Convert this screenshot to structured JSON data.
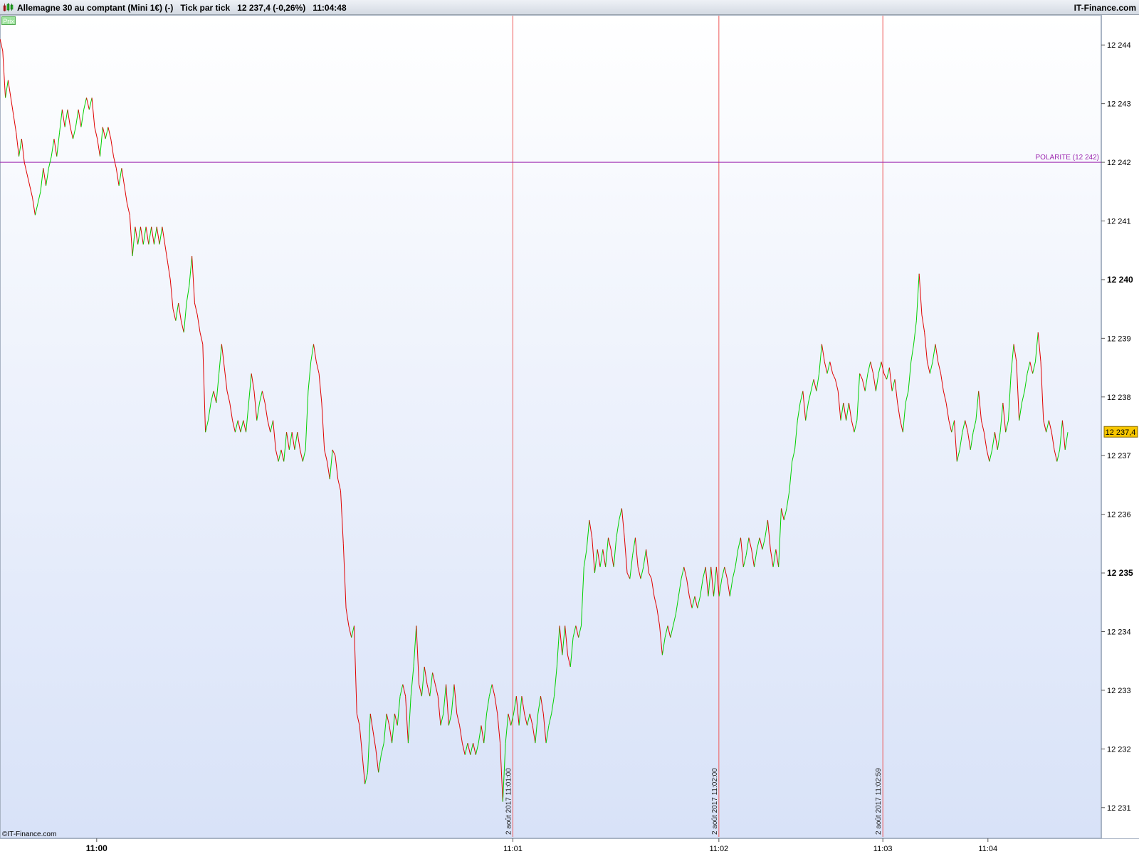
{
  "header": {
    "title": "Allemagne 30 au comptant (Mini 1€) (-)   Tick par tick   12 237,4 (-0,26%)   11:04:48",
    "brand": "IT-Finance.com"
  },
  "chart_controls": {
    "prix_label": "Prix"
  },
  "footer": {
    "copyright": "©IT-Finance.com"
  },
  "colors": {
    "up": "#00d000",
    "down": "#e00000",
    "polarity": "#9c27b0",
    "vline": "#ee5a5a",
    "current_badge": "#f7c600"
  },
  "chart_data": {
    "type": "line",
    "title": "Allemagne 30 au comptant (Mini 1€) (-)",
    "subtitle": "Tick par tick",
    "ylim": [
      12230.5,
      12244.5
    ],
    "y_ticks": [
      {
        "value": 12231,
        "label": "12 231",
        "bold": false
      },
      {
        "value": 12232,
        "label": "12 232",
        "bold": false
      },
      {
        "value": 12233,
        "label": "12 233",
        "bold": false
      },
      {
        "value": 12234,
        "label": "12 234",
        "bold": false
      },
      {
        "value": 12235,
        "label": "12 235",
        "bold": true
      },
      {
        "value": 12236,
        "label": "12 236",
        "bold": false
      },
      {
        "value": 12237,
        "label": "12 237",
        "bold": false
      },
      {
        "value": 12238,
        "label": "12 238",
        "bold": false
      },
      {
        "value": 12239,
        "label": "12 239",
        "bold": false
      },
      {
        "value": 12240,
        "label": "12 240",
        "bold": true
      },
      {
        "value": 12241,
        "label": "12 241",
        "bold": false
      },
      {
        "value": 12242,
        "label": "12 242",
        "bold": false
      },
      {
        "value": 12243,
        "label": "12 243",
        "bold": false
      },
      {
        "value": 12244,
        "label": "12 244",
        "bold": false
      }
    ],
    "x_ticks": [
      {
        "tick": 23,
        "label": "11:00",
        "bold": true
      },
      {
        "tick": 122,
        "label": "11:01",
        "bold": false
      },
      {
        "tick": 171,
        "label": "11:02",
        "bold": false
      },
      {
        "tick": 210,
        "label": "11:03",
        "bold": false
      },
      {
        "tick": 235,
        "label": "11:04",
        "bold": false
      }
    ],
    "vertical_markers": [
      {
        "tick": 122,
        "label": "2 août 2017  11:01:00"
      },
      {
        "tick": 171,
        "label": "2 août 2017  11:02:00"
      },
      {
        "tick": 210,
        "label": "2 août 2017  11:02:59"
      }
    ],
    "polarity": {
      "value": 12242,
      "label": "POLARITE (12 242)"
    },
    "current": {
      "value": 12237.4,
      "label": "12 237,4"
    },
    "series": [
      {
        "values": [
          12244.1,
          12243.9,
          12243.1,
          12243.4,
          12243.1,
          12242.8,
          12242.5,
          12242.1,
          12242.4,
          12242.0,
          12241.8,
          12241.6,
          12241.4,
          12241.1,
          12241.3,
          12241.5,
          12241.9,
          12241.6,
          12241.9,
          12242.1,
          12242.4,
          12242.1,
          12242.5,
          12242.9,
          12242.6,
          12242.9,
          12242.6,
          12242.4,
          12242.6,
          12242.9,
          12242.6,
          12242.9,
          12243.1,
          12242.9,
          12243.1,
          12242.6,
          12242.4,
          12242.1,
          12242.6,
          12242.4,
          12242.6,
          12242.4,
          12242.1,
          12241.9,
          12241.6,
          12241.9,
          12241.6,
          12241.3,
          12241.1,
          12240.4,
          12240.9,
          12240.6,
          12240.9,
          12240.6,
          12240.9,
          12240.6,
          12240.9,
          12240.6,
          12240.9,
          12240.6,
          12240.9,
          12240.6,
          12240.3,
          12240.0,
          12239.5,
          12239.3,
          12239.6,
          12239.3,
          12239.1,
          12239.6,
          12239.9,
          12240.4,
          12239.6,
          12239.4,
          12239.1,
          12238.9,
          12237.4,
          12237.6,
          12237.9,
          12238.1,
          12237.9,
          12238.4,
          12238.9,
          12238.5,
          12238.1,
          12237.9,
          12237.6,
          12237.4,
          12237.6,
          12237.4,
          12237.6,
          12237.4,
          12237.9,
          12238.4,
          12238.1,
          12237.6,
          12237.9,
          12238.1,
          12237.9,
          12237.6,
          12237.4,
          12237.6,
          12237.1,
          12236.9,
          12237.1,
          12236.9,
          12237.4,
          12237.1,
          12237.4,
          12237.1,
          12237.4,
          12237.1,
          12236.9,
          12237.1,
          12238.1,
          12238.6,
          12238.9,
          12238.6,
          12238.4,
          12237.9,
          12237.1,
          12236.9,
          12236.6,
          12237.1,
          12237.0,
          12236.6,
          12236.4,
          12235.5,
          12234.4,
          12234.1,
          12233.9,
          12234.1,
          12232.6,
          12232.4,
          12231.9,
          12231.4,
          12231.6,
          12232.6,
          12232.3,
          12232.0,
          12231.6,
          12231.9,
          12232.1,
          12232.6,
          12232.4,
          12232.1,
          12232.6,
          12232.4,
          12232.9,
          12233.1,
          12232.9,
          12232.1,
          12232.9,
          12233.4,
          12234.1,
          12233.1,
          12232.9,
          12233.4,
          12233.1,
          12232.9,
          12233.3,
          12233.1,
          12232.9,
          12232.4,
          12232.6,
          12233.1,
          12232.4,
          12232.6,
          12233.1,
          12232.6,
          12232.4,
          12232.1,
          12231.9,
          12232.1,
          12231.9,
          12232.1,
          12231.9,
          12232.1,
          12232.4,
          12232.1,
          12232.6,
          12232.9,
          12233.1,
          12232.9,
          12232.6,
          12232.1,
          12231.1,
          12232.1,
          12232.6,
          12232.4,
          12232.6,
          12232.9,
          12232.4,
          12232.9,
          12232.6,
          12232.4,
          12232.6,
          12232.4,
          12232.1,
          12232.6,
          12232.9,
          12232.6,
          12232.1,
          12232.4,
          12232.6,
          12232.9,
          12233.4,
          12234.1,
          12233.6,
          12234.1,
          12233.6,
          12233.4,
          12233.9,
          12234.1,
          12233.9,
          12234.1,
          12235.1,
          12235.4,
          12235.9,
          12235.6,
          12235.0,
          12235.4,
          12235.1,
          12235.4,
          12235.1,
          12235.6,
          12235.4,
          12235.1,
          12235.6,
          12235.9,
          12236.1,
          12235.6,
          12235.0,
          12234.9,
          12235.3,
          12235.6,
          12235.1,
          12234.9,
          12235.1,
          12235.4,
          12235.0,
          12234.9,
          12234.6,
          12234.4,
          12234.1,
          12233.6,
          12233.9,
          12234.1,
          12233.9,
          12234.1,
          12234.3,
          12234.6,
          12234.9,
          12235.1,
          12234.9,
          12234.6,
          12234.4,
          12234.6,
          12234.4,
          12234.6,
          12234.9,
          12235.1,
          12234.6,
          12235.1,
          12234.6,
          12235.1,
          12234.6,
          12234.9,
          12235.1,
          12234.9,
          12234.6,
          12234.9,
          12235.1,
          12235.4,
          12235.6,
          12235.1,
          12235.3,
          12235.6,
          12235.4,
          12235.1,
          12235.4,
          12235.6,
          12235.4,
          12235.6,
          12235.9,
          12235.4,
          12235.1,
          12235.4,
          12235.1,
          12236.1,
          12235.9,
          12236.1,
          12236.4,
          12236.9,
          12237.1,
          12237.6,
          12237.9,
          12238.1,
          12237.6,
          12237.9,
          12238.1,
          12238.3,
          12238.1,
          12238.4,
          12238.9,
          12238.6,
          12238.4,
          12238.6,
          12238.4,
          12238.3,
          12238.1,
          12237.6,
          12237.9,
          12237.6,
          12237.9,
          12237.6,
          12237.4,
          12237.6,
          12238.4,
          12238.3,
          12238.1,
          12238.4,
          12238.6,
          12238.4,
          12238.1,
          12238.4,
          12238.6,
          12238.4,
          12238.3,
          12238.5,
          12238.1,
          12238.3,
          12237.9,
          12237.6,
          12237.4,
          12237.9,
          12238.1,
          12238.6,
          12238.9,
          12239.3,
          12240.1,
          12239.4,
          12239.1,
          12238.6,
          12238.4,
          12238.6,
          12238.9,
          12238.6,
          12238.4,
          12238.1,
          12237.9,
          12237.6,
          12237.4,
          12237.6,
          12236.9,
          12237.1,
          12237.4,
          12237.6,
          12237.4,
          12237.1,
          12237.4,
          12237.6,
          12238.1,
          12237.6,
          12237.4,
          12237.1,
          12236.9,
          12237.1,
          12237.4,
          12237.1,
          12237.4,
          12237.9,
          12237.4,
          12237.6,
          12238.4,
          12238.9,
          12238.6,
          12237.6,
          12237.9,
          12238.1,
          12238.4,
          12238.6,
          12238.4,
          12238.6,
          12239.1,
          12238.6,
          12237.6,
          12237.4,
          12237.6,
          12237.4,
          12237.1,
          12236.9,
          12237.1,
          12237.6,
          12237.1,
          12237.4
        ]
      }
    ]
  }
}
